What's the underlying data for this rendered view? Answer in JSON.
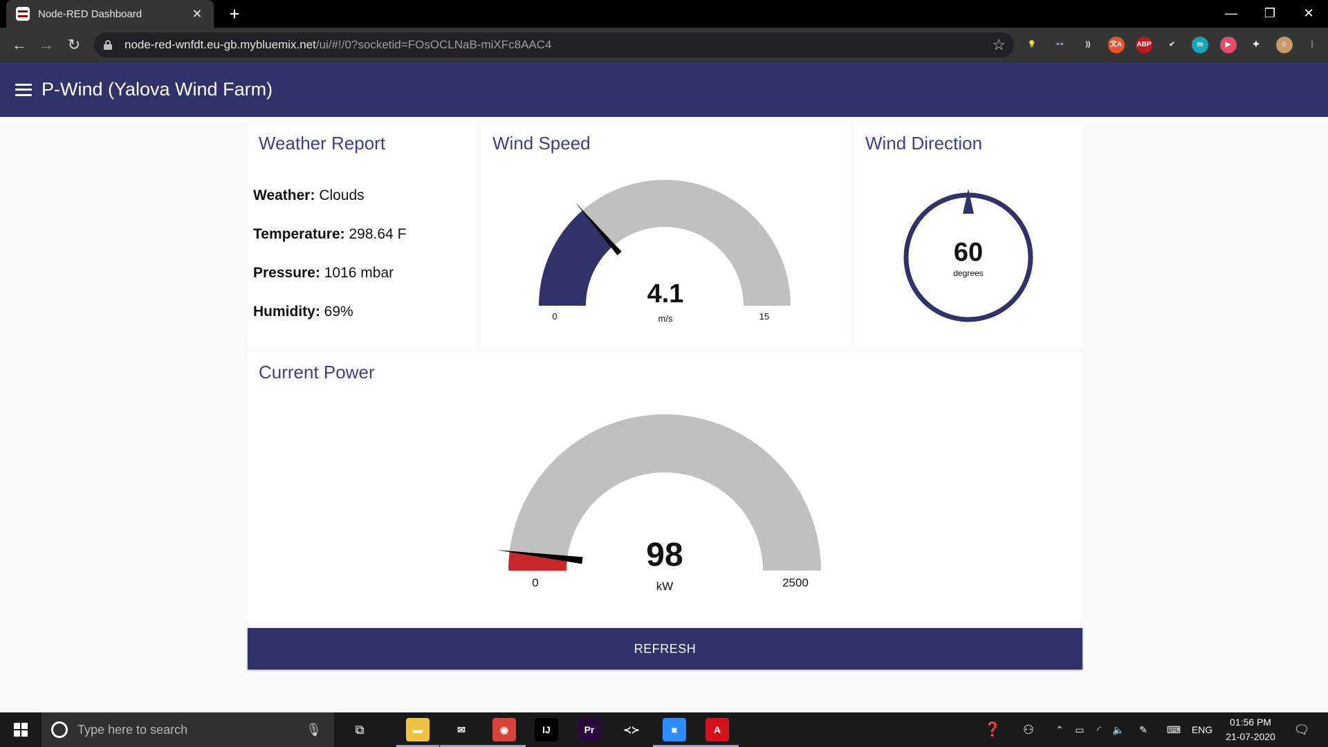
{
  "browser": {
    "tab_title": "Node-RED Dashboard",
    "tab_close": "✕",
    "new_tab": "+",
    "url_host": "node-red-wnfdt.eu-gb.mybluemix.net",
    "url_path": "/ui/#!/0?socketid=FOsOCLNaB-miXFc8AAC4",
    "window_controls": [
      "—",
      "❐",
      "✕"
    ],
    "extensions": [
      {
        "name": "bulb-extension-icon",
        "label": "💡",
        "color": "#353535"
      },
      {
        "name": "owl-extension-icon",
        "label": "👓",
        "color": "#353535"
      },
      {
        "name": "wifi-extension-icon",
        "label": "))",
        "color": "#353535"
      },
      {
        "name": "translate-extension-icon",
        "label": "文A",
        "color": "#e8542a"
      },
      {
        "name": "adblock-extension-icon",
        "label": "ABP",
        "color": "#c4161c"
      },
      {
        "name": "check-extension-icon",
        "label": "✔",
        "color": "#353535"
      },
      {
        "name": "m-extension-icon",
        "label": "m",
        "color": "#17a5b9"
      },
      {
        "name": "video-extension-icon",
        "label": "▶",
        "color": "#e54e6a"
      },
      {
        "name": "puzzle-extension-icon",
        "label": "✚",
        "color": "#353535"
      },
      {
        "name": "profile-avatar-icon",
        "label": "☺",
        "color": "#c79a6a"
      },
      {
        "name": "kebab-menu-icon",
        "label": "⋮",
        "color": "#353535"
      }
    ]
  },
  "app": {
    "title": "P-Wind (Yalova Wind Farm)"
  },
  "weather": {
    "title": "Weather Report",
    "rows": [
      {
        "label": "Weather:",
        "value": "Clouds"
      },
      {
        "label": "Temperature:",
        "value": "298.64 F"
      },
      {
        "label": "Pressure:",
        "value": "1016 mbar"
      },
      {
        "label": "Humidity:",
        "value": "69%"
      }
    ]
  },
  "wind_speed": {
    "title": "Wind Speed",
    "value": "4.1",
    "units": "m/s",
    "min": "0",
    "max": "15",
    "fill_fraction": 0.273,
    "fill_color": "#32326b",
    "track_color": "#c0c0c0"
  },
  "wind_direction": {
    "title": "Wind Direction",
    "value": "60",
    "units": "degrees",
    "ring_color": "#32326b"
  },
  "power": {
    "title": "Current Power",
    "value": "98",
    "units": "kW",
    "min": "0",
    "max": "2500",
    "fill_fraction": 0.039,
    "fill_color": "#c8282b",
    "track_color": "#c0c0c0"
  },
  "refresh_label": "REFRESH",
  "taskbar": {
    "search_placeholder": "Type here to search",
    "apps": [
      {
        "name": "file-explorer-icon",
        "label": "▬",
        "color": "#f0c040"
      },
      {
        "name": "mail-icon",
        "label": "✉",
        "color": "#1a1a1a"
      },
      {
        "name": "chrome-icon",
        "label": "◉",
        "color": "#d9443a"
      },
      {
        "name": "intellij-icon",
        "label": "IJ",
        "color": "#000"
      },
      {
        "name": "premiere-icon",
        "label": "Pr",
        "color": "#2a0a3a"
      },
      {
        "name": "vscode-icon",
        "label": "≺≻",
        "color": "#1a1a1a"
      },
      {
        "name": "zoom-icon",
        "label": "■",
        "color": "#2d8cff"
      },
      {
        "name": "acrobat-icon",
        "label": "A",
        "color": "#d4121b"
      }
    ],
    "language": "ENG",
    "time": "01:56 PM",
    "date": "21-07-2020"
  }
}
